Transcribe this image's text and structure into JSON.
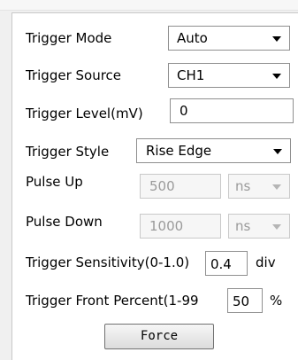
{
  "trigger_mode": {
    "label": "Trigger Mode",
    "value": "Auto"
  },
  "trigger_source": {
    "label": "Trigger Source",
    "value": "CH1"
  },
  "trigger_level": {
    "label": "Trigger Level(mV)",
    "value": "0"
  },
  "trigger_style": {
    "label": "Trigger Style",
    "value": "Rise Edge"
  },
  "pulse_up": {
    "label": "Pulse Up",
    "value": "500",
    "unit": "ns"
  },
  "pulse_down": {
    "label": "Pulse Down",
    "value": "1000",
    "unit": "ns"
  },
  "trigger_sensitivity": {
    "label": "Trigger Sensitivity(0-1.0)",
    "value": "0.4",
    "unit": "div"
  },
  "trigger_front_percent": {
    "label": "Trigger Front Percent(1-99",
    "value": "50",
    "unit": "%"
  },
  "force_button": {
    "label": "Force"
  }
}
